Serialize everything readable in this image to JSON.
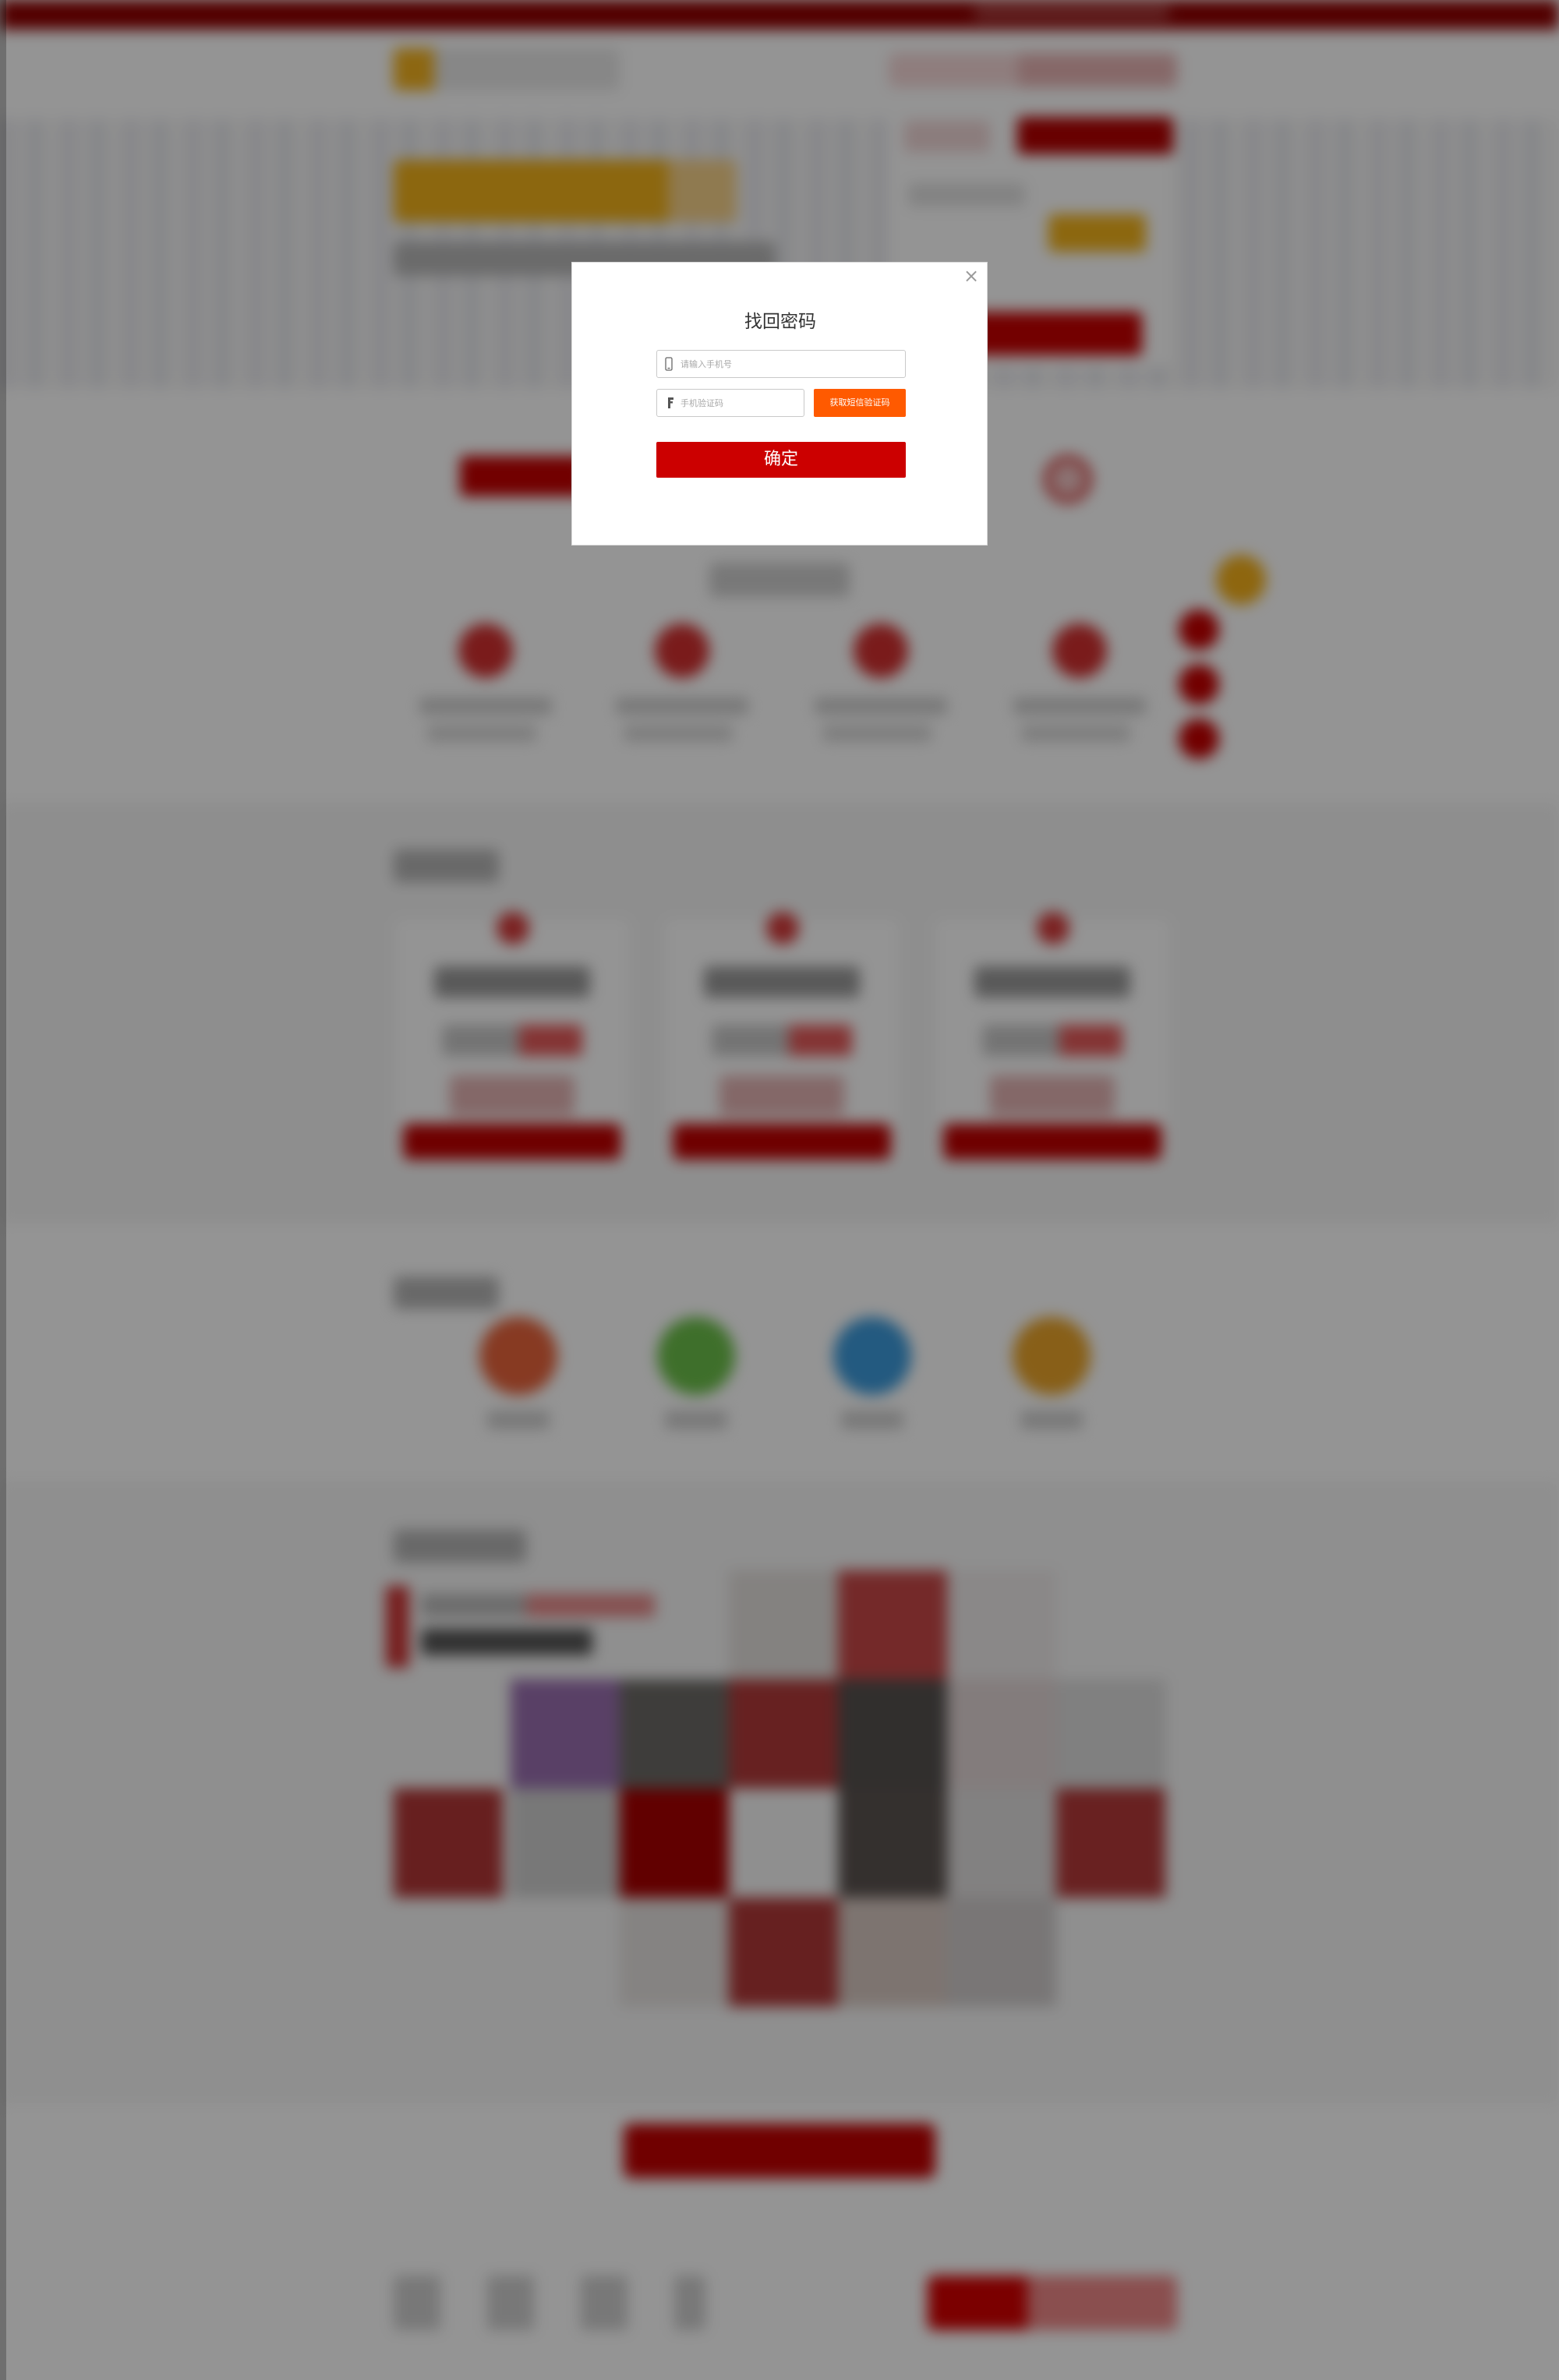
{
  "modal": {
    "title": "找回密码",
    "close_glyph": "×",
    "phone_placeholder": "请输入手机号",
    "code_placeholder": "手机验证码",
    "sms_button": "获取短信验证码",
    "confirm_button": "确定",
    "phone_icon": "mobile-phone-icon",
    "code_icon": "key-icon"
  },
  "colors": {
    "brand_red": "#cc0000",
    "top_bar_red": "#8e0000",
    "sms_orange": "#ff5a00",
    "accent_gold": "#f2b21a",
    "overlay": "rgba(0,0,0,0.42)"
  },
  "background_feature_colors": [
    "#e8643c",
    "#6cc04a",
    "#3d9bdc",
    "#eaa42a"
  ]
}
